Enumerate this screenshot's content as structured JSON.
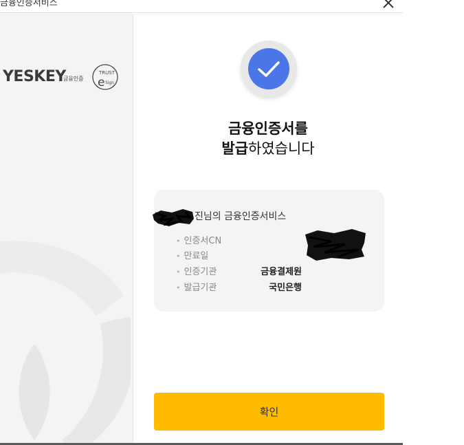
{
  "window": {
    "title": "금융인증서비스",
    "close_icon": "close-icon"
  },
  "branding": {
    "yeskey_logo": "YESKEY",
    "yeskey_sub": "금융인증",
    "trust_logo": "TRUST e Sign"
  },
  "status": {
    "icon": "check-icon",
    "accent_color": "#4a76e8",
    "headline_line1": "금융인증서를",
    "headline_bold": "발급",
    "headline_rest": "하였습니다"
  },
  "certificate": {
    "owner_suffix": "진님의 금융인증서비스",
    "fields": [
      {
        "label": "인증서CN",
        "value": ""
      },
      {
        "label": "만료일",
        "value": ""
      },
      {
        "label": "인증기관",
        "value": "금융결제원"
      },
      {
        "label": "발급기관",
        "value": "국민은행"
      }
    ]
  },
  "actions": {
    "confirm_label": "확인",
    "confirm_color": "#ffbb00"
  }
}
